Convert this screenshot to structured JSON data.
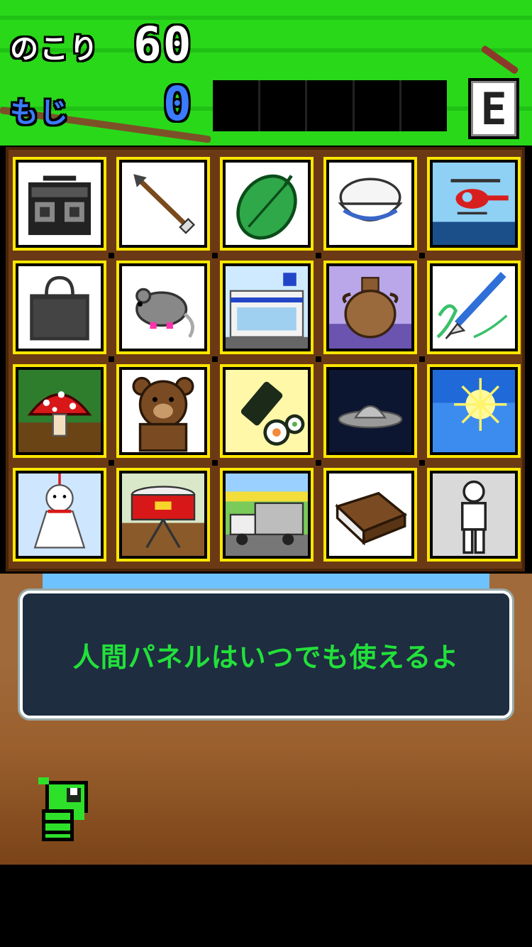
{
  "hud": {
    "remaining_label": "のこり",
    "remaining_value": "60",
    "letters_label": "もじ",
    "letters_value": "0",
    "word_slots": 5,
    "level": "E"
  },
  "board": {
    "tiles": [
      {
        "name": "radio-cassette-tile",
        "icon": "boombox-icon"
      },
      {
        "name": "arrow-tile",
        "icon": "arrow-icon"
      },
      {
        "name": "leaf-tile",
        "icon": "leaf-icon"
      },
      {
        "name": "rice-bowl-tile",
        "icon": "rice-bowl-icon"
      },
      {
        "name": "helicopter-tile",
        "icon": "helicopter-icon"
      },
      {
        "name": "bag-tile",
        "icon": "bag-icon"
      },
      {
        "name": "mouse-tile",
        "icon": "mouse-icon"
      },
      {
        "name": "convenience-store-tile",
        "icon": "store-icon"
      },
      {
        "name": "vase-tile",
        "icon": "vase-icon"
      },
      {
        "name": "brush-tile",
        "icon": "brush-icon"
      },
      {
        "name": "mushroom-tile",
        "icon": "mushroom-icon"
      },
      {
        "name": "bear-tile",
        "icon": "bear-icon"
      },
      {
        "name": "sushi-roll-tile",
        "icon": "sushi-roll-icon"
      },
      {
        "name": "ufo-tile",
        "icon": "ufo-icon"
      },
      {
        "name": "sun-tile",
        "icon": "sun-icon"
      },
      {
        "name": "teru-teru-bozu-tile",
        "icon": "teru-teru-bozu-icon"
      },
      {
        "name": "drum-tile",
        "icon": "drum-icon"
      },
      {
        "name": "truck-tile",
        "icon": "truck-icon"
      },
      {
        "name": "book-tile",
        "icon": "book-icon"
      },
      {
        "name": "human-panel-tile",
        "icon": "human-icon"
      }
    ]
  },
  "message": {
    "text": "人間パネルはいつでも使えるよ"
  },
  "mascot": {
    "icon": "green-caterpillar-icon"
  },
  "colors": {
    "grass": "#2ad81a",
    "tile_border": "#ffe600",
    "board_bg": "#6b3a14",
    "message_text": "#22e03a",
    "blue_text": "#3b7bff"
  }
}
